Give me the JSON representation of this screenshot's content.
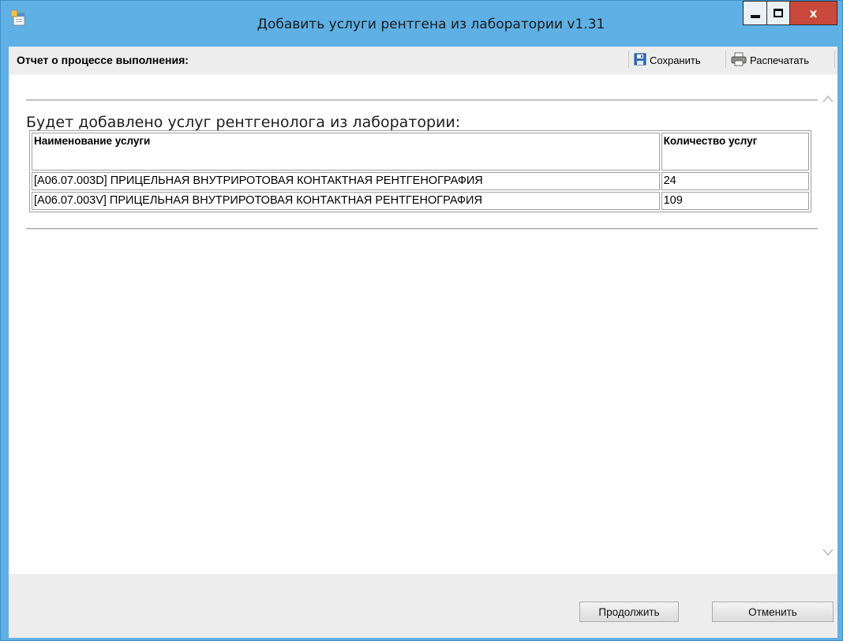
{
  "window": {
    "title": "Добавить услуги рентгена из лаборатории v1.31",
    "close_glyph": "x"
  },
  "toolbar": {
    "title": "Отчет о процессе выполнения:",
    "save_label": "Сохранить",
    "print_label": "Распечатать"
  },
  "report": {
    "heading": "Будет добавлено услуг рентгенолога из лаборатории:",
    "columns": [
      "Наименование услуги",
      "Количество услуг"
    ],
    "rows": [
      {
        "name": "[A06.07.003D] ПРИЦЕЛЬНАЯ ВНУТРИРОТОВАЯ КОНТАКТНАЯ РЕНТГЕНОГРАФИЯ",
        "qty": "24"
      },
      {
        "name": "[A06.07.003V] ПРИЦЕЛЬНАЯ ВНУТРИРОТОВАЯ КОНТАКТНАЯ РЕНТГЕНОГРАФИЯ",
        "qty": "109"
      }
    ]
  },
  "footer": {
    "continue_label": "Продолжить",
    "cancel_label": "Отменить"
  },
  "icons": {
    "app": "app-window-icon",
    "save": "floppy-disk-icon",
    "print": "printer-icon",
    "scroll_up": "chevron-up-icon",
    "scroll_down": "chevron-down-icon"
  },
  "colors": {
    "titlebar": "#5fb0e4",
    "close_button": "#c94a3c",
    "panel": "#ededed"
  }
}
